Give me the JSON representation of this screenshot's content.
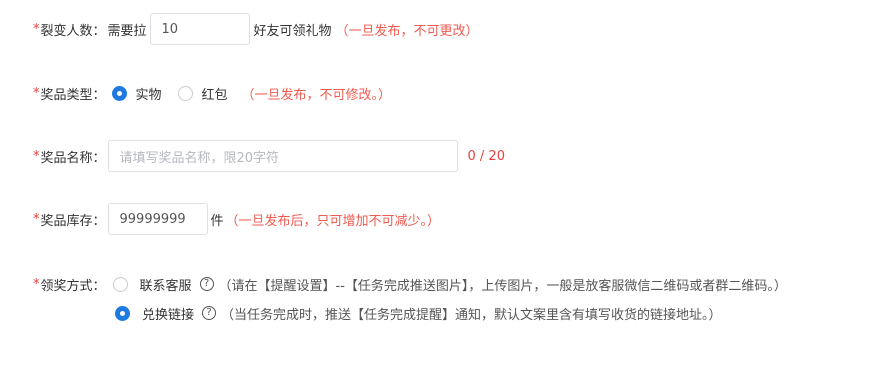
{
  "fission_count": {
    "required_mark": "*",
    "label": "裂变人数：",
    "prefix": "需要拉",
    "value": "10",
    "suffix": "好友可领礼物",
    "note": "（一旦发布，不可更改）"
  },
  "prize_type": {
    "required_mark": "*",
    "label": "奖品类型：",
    "options": [
      {
        "label": "实物",
        "selected": true
      },
      {
        "label": "红包",
        "selected": false
      }
    ],
    "note": "（一旦发布，不可修改。）"
  },
  "prize_name": {
    "required_mark": "*",
    "label": "奖品名称：",
    "placeholder": "请填写奖品名称，限20字符",
    "counter": "0 / 20"
  },
  "prize_stock": {
    "required_mark": "*",
    "label": "奖品库存：",
    "value": "99999999",
    "unit": "件",
    "note": "（一旦发布后，只可增加不可减少。）"
  },
  "claim_method": {
    "required_mark": "*",
    "label": "领奖方式：",
    "options": [
      {
        "label": "联系客服",
        "selected": false,
        "help_icon": "question-circle-icon",
        "help_glyph": "?",
        "note": "（请在【提醒设置】--【任务完成推送图片】，上传图片，一般是放客服微信二维码或者群二维码。）"
      },
      {
        "label": "兑换链接",
        "selected": true,
        "help_icon": "question-circle-icon",
        "help_glyph": "?",
        "note": "（当任务完成时，推送【任务完成提醒】通知，默认文案里含有填写收货的链接地址。）"
      }
    ]
  },
  "colors": {
    "required": "#e6403f",
    "note": "#f05a4f",
    "primary": "#1f7ae0",
    "border": "#dcdfe6",
    "placeholder": "#b5b8bf",
    "text": "#333333"
  }
}
